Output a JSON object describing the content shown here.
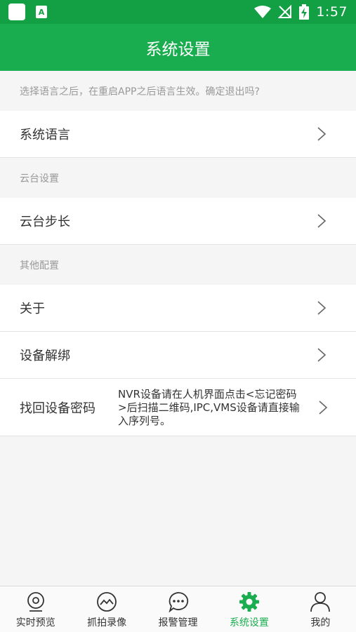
{
  "status_bar": {
    "time": "1:57"
  },
  "header": {
    "title": "系统设置"
  },
  "hint": "选择语言之后，在重启APP之后语言生效。确定退出吗?",
  "rows": {
    "system_language": "系统语言",
    "ptz_section": "云台设置",
    "ptz_step": "云台步长",
    "other_section": "其他配置",
    "about": "关于",
    "unbind": "设备解绑",
    "recover_password": "找回设备密码",
    "recover_password_desc": "NVR设备请在人机界面点击<忘记密码>后扫描二维码,IPC,VMS设备请直接输入序列号。"
  },
  "bottom_nav": [
    {
      "label": "实时预览",
      "icon": "camera-icon"
    },
    {
      "label": "抓拍录像",
      "icon": "photo-icon"
    },
    {
      "label": "报警管理",
      "icon": "chat-icon"
    },
    {
      "label": "系统设置",
      "icon": "gear-icon",
      "active": true
    },
    {
      "label": "我的",
      "icon": "user-icon"
    }
  ],
  "colors": {
    "primary": "#1aad4f",
    "status_bar": "#139f43"
  }
}
